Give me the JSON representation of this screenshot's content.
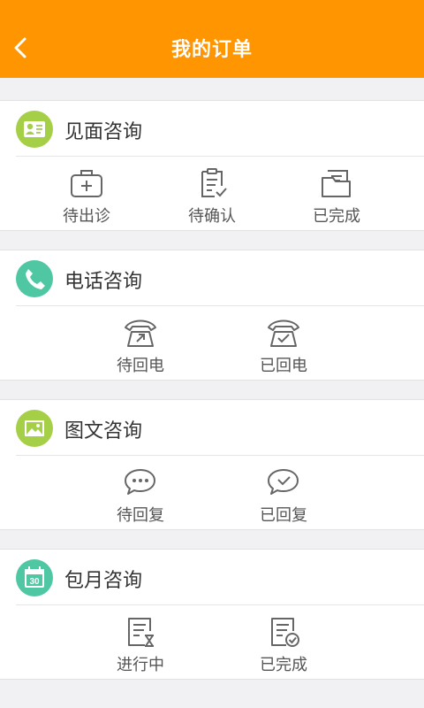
{
  "header": {
    "title": "我的订单",
    "back_icon": "back-arrow-icon",
    "bg": "#ff9500"
  },
  "sections": [
    {
      "title": "见面咨询",
      "icon": "contact-card-icon",
      "color": "#a5cf47",
      "items": [
        {
          "label": "待出诊",
          "icon": "medical-kit-icon"
        },
        {
          "label": "待确认",
          "icon": "clipboard-check-icon"
        },
        {
          "label": "已完成",
          "icon": "folder-icon"
        }
      ]
    },
    {
      "title": "电话咨询",
      "icon": "phone-icon",
      "color": "#4fc7a2",
      "items": [
        {
          "label": "待回电",
          "icon": "phone-outgoing-icon"
        },
        {
          "label": "已回电",
          "icon": "phone-check-icon"
        }
      ]
    },
    {
      "title": "图文咨询",
      "icon": "image-icon",
      "color": "#a5cf47",
      "items": [
        {
          "label": "待回复",
          "icon": "chat-dots-icon"
        },
        {
          "label": "已回复",
          "icon": "chat-check-icon"
        }
      ]
    },
    {
      "title": "包月咨询",
      "icon": "calendar-icon",
      "color": "#4fc7a2",
      "calendar_day": "30",
      "items": [
        {
          "label": "进行中",
          "icon": "doc-hourglass-icon"
        },
        {
          "label": "已完成",
          "icon": "doc-check-icon"
        }
      ]
    }
  ]
}
